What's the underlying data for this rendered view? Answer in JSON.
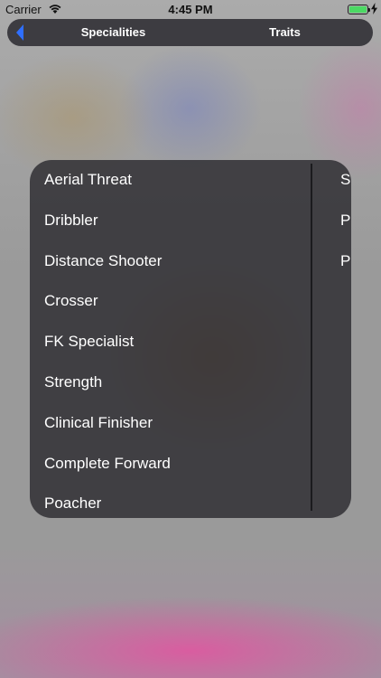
{
  "status_bar": {
    "carrier": "Carrier",
    "time": "4:45 PM",
    "icons": [
      "wifi-icon",
      "battery-icon",
      "charging-icon"
    ],
    "battery_color": "#4cd964"
  },
  "header": {
    "back_icon": "back-arrow-icon",
    "accent": "#2f6fff",
    "tabs": [
      {
        "label": "Specialities"
      },
      {
        "label": "Traits"
      }
    ]
  },
  "popup": {
    "specialities": [
      {
        "label": "Aerial Threat"
      },
      {
        "label": "Dribbler"
      },
      {
        "label": "Distance Shooter"
      },
      {
        "label": "Crosser"
      },
      {
        "label": "FK Specialist"
      },
      {
        "label": "Strength"
      },
      {
        "label": "Clinical Finisher"
      },
      {
        "label": "Complete Forward"
      },
      {
        "label": "Poacher"
      }
    ],
    "traits_partial": [
      {
        "label": "S"
      },
      {
        "label": "P"
      },
      {
        "label": "P"
      }
    ]
  }
}
